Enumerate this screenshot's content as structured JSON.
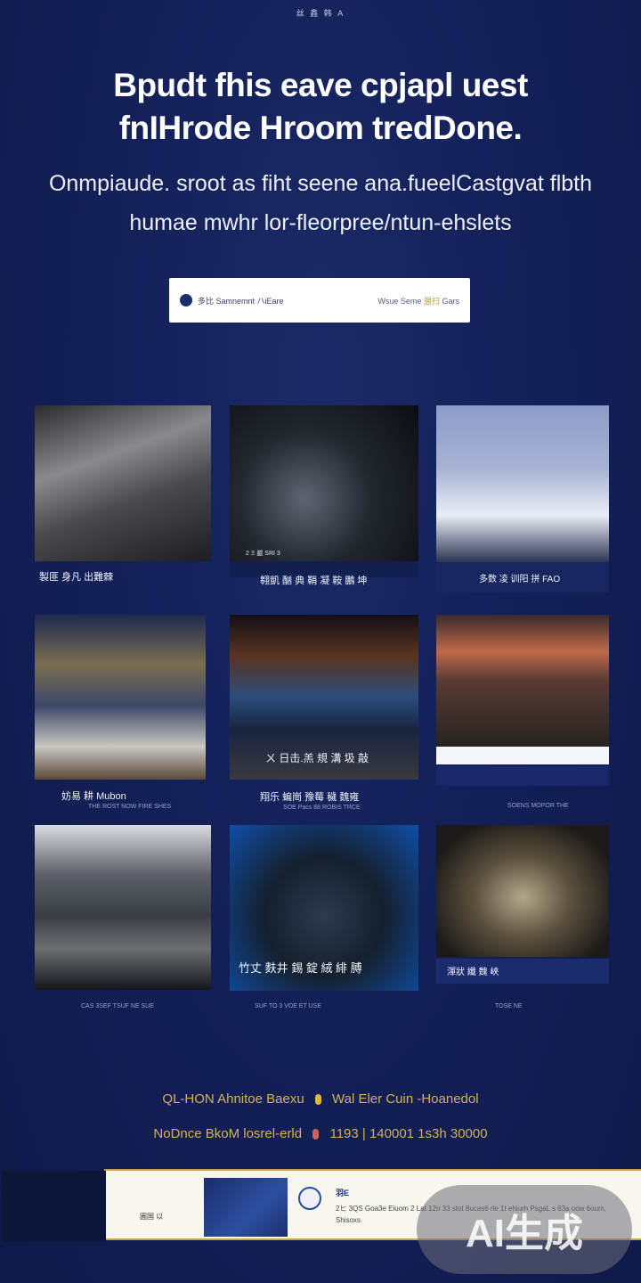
{
  "top_mark": "丝 鑫 韩 A",
  "headline": {
    "line1": "Bpudt fhis eave cpjapl uest",
    "line2": "fnIHrode Hroom tredDone."
  },
  "subtitle": {
    "line1": "Onmpiaude. sroot as fiht seene ana.fueelCastgvat flbth",
    "line2": "humae mwhr lor-fleorpree/ntun-ehslets"
  },
  "search": {
    "left_text": "多比 Samnemnt ハiEare",
    "right_text": "Wsue Seme",
    "right_accent": "盟扫",
    "right_tail": "Gars"
  },
  "cards": [
    {
      "caption": "製匪 身凡   出難棘",
      "subcaption": ""
    },
    {
      "caption": "翱凱  酗 典 鞘 凝 鞍 鵬 坤",
      "subcaption": "2 Ξ 腿 SRI 3"
    },
    {
      "caption": "多数 凌 训阳 拼 FAO",
      "subcaption": ""
    },
    {
      "caption": "妨易 耕  Mubon",
      "subcaption": "THE ROST NOW FIRE SHES"
    },
    {
      "caption": "翔乐  蝙崗 豫莓 穢 魏雍",
      "subcaption": "SOE Pacs 88 ROBIS TRCE"
    },
    {
      "caption": "",
      "subcaption": "SOENS MOPOR THE"
    },
    {
      "caption": "",
      "subcaption": "CAS 3SEF TSUF NE   SUE"
    },
    {
      "caption": "竹丈  麩井 錫 錠 絨 緋 膊",
      "subcaption": "SUF TO 3 VOE ET USE"
    },
    {
      "caption": "渾狀 纖 魏 峽",
      "subcaption": "TOSE NE"
    }
  ],
  "overlay_texts": [
    "ㄨ 日击.羔 規 溝 圾 敲",
    ""
  ],
  "info": {
    "line1_left": "QL-HON Ahnitoe Baexu",
    "line1_right": "Wal Eler Cuin -Hoanedol",
    "line2_left": "NoDnce BkoM losrel-erld",
    "line2_right": "1193 | 140001 1s3h 30000"
  },
  "footer": {
    "label": "圓国 以",
    "title": "羽E",
    "text": "2ヒ 3QS Goa3e Eiuom 2 Lat 12n 33 stot 8ucas6 rle 1t ehiurh PsgaL s 63a oow 6oum, Shisoxs"
  },
  "ai_badge": "AI生成"
}
